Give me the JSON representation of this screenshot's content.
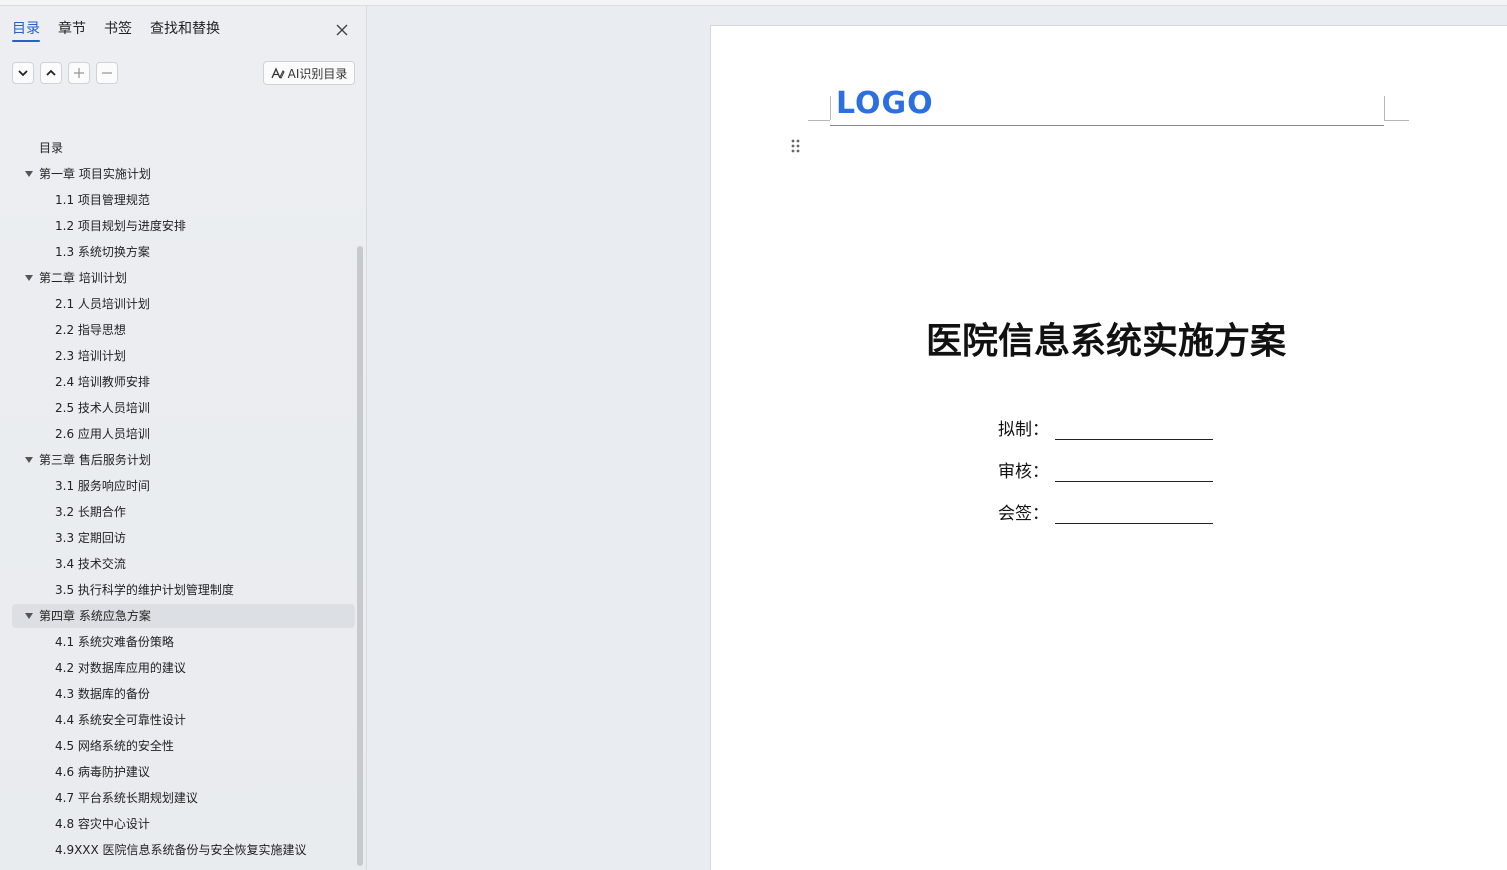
{
  "sidebar": {
    "tabs": [
      {
        "label": "目录",
        "active": true
      },
      {
        "label": "章节",
        "active": false
      },
      {
        "label": "书签",
        "active": false
      },
      {
        "label": "查找和替换",
        "active": false
      }
    ],
    "ai_button_label": "AI识别目录",
    "toc": [
      {
        "label": "目录",
        "level": 0
      },
      {
        "label": "第一章  项目实施计划",
        "level": 1
      },
      {
        "label": "1.1 项目管理规范",
        "level": 2
      },
      {
        "label": "1.2 项目规划与进度安排",
        "level": 2
      },
      {
        "label": "1.3 系统切换方案",
        "level": 2
      },
      {
        "label": "第二章  培训计划",
        "level": 1
      },
      {
        "label": "2.1 人员培训计划",
        "level": 2
      },
      {
        "label": "2.2 指导思想",
        "level": 2
      },
      {
        "label": "2.3 培训计划",
        "level": 2
      },
      {
        "label": "2.4 培训教师安排",
        "level": 2
      },
      {
        "label": "2.5 技术人员培训",
        "level": 2
      },
      {
        "label": "2.6 应用人员培训",
        "level": 2
      },
      {
        "label": "第三章  售后服务计划",
        "level": 1
      },
      {
        "label": "3.1 服务响应时间",
        "level": 2
      },
      {
        "label": "3.2 长期合作",
        "level": 2
      },
      {
        "label": "3.3 定期回访",
        "level": 2
      },
      {
        "label": "3.4 技术交流",
        "level": 2
      },
      {
        "label": "3.5 执行科学的维护计划管理制度",
        "level": 2
      },
      {
        "label": "第四章  系统应急方案",
        "level": 1,
        "selected": true
      },
      {
        "label": "4.1 系统灾难备份策略",
        "level": 2
      },
      {
        "label": "4.2  对数据库应用的建议",
        "level": 2
      },
      {
        "label": "4.3 数据库的备份",
        "level": 2
      },
      {
        "label": "4.4 系统安全可靠性设计",
        "level": 2
      },
      {
        "label": "4.5 网络系统的安全性",
        "level": 2
      },
      {
        "label": "4.6 病毒防护建议",
        "level": 2
      },
      {
        "label": "4.7 平台系统长期规划建议",
        "level": 2
      },
      {
        "label": "4.8 容灾中心设计",
        "level": 2
      },
      {
        "label": "4.9XXX 医院信息系统备份与安全恢复实施建议",
        "level": 2
      }
    ]
  },
  "document": {
    "logo_text": "LOGO",
    "title": "医院信息系统实施方案",
    "sign_fields": [
      {
        "label": "拟制："
      },
      {
        "label": "审核："
      },
      {
        "label": "会签："
      }
    ]
  },
  "colors": {
    "accent": "#2563c9",
    "logo": "#2b6fe0"
  }
}
